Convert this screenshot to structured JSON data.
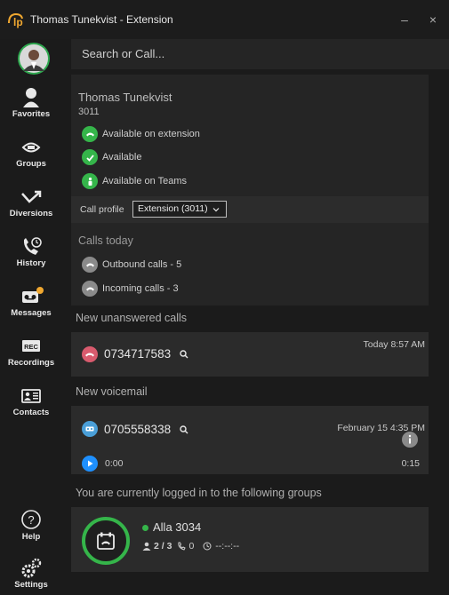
{
  "window": {
    "title": "Thomas Tunekvist - Extension",
    "minimize": "–",
    "close": "×"
  },
  "search": {
    "placeholder": "Search or Call..."
  },
  "sidebar": {
    "items": [
      {
        "label": "Favorites",
        "icon": "person-icon"
      },
      {
        "label": "Groups",
        "icon": "groups-icon"
      },
      {
        "label": "Diversions",
        "icon": "diversion-arrow-icon"
      },
      {
        "label": "History",
        "icon": "history-phone-icon"
      },
      {
        "label": "Messages",
        "icon": "voicemail-icon"
      },
      {
        "label": "Recordings",
        "icon": "rec-icon"
      },
      {
        "label": "Contacts",
        "icon": "contact-card-icon"
      },
      {
        "label": "Help",
        "icon": "help-icon"
      },
      {
        "label": "Settings",
        "icon": "gears-icon"
      }
    ]
  },
  "profile": {
    "name": "Thomas Tunekvist",
    "extension": "3011",
    "statuses": [
      {
        "text": "Available on extension",
        "icon": "phone-icon"
      },
      {
        "text": "Available",
        "icon": "check-icon"
      },
      {
        "text": "Available on Teams",
        "icon": "teams-icon"
      }
    ],
    "call_profile_label": "Call profile",
    "call_profile_value": "Extension (3011)"
  },
  "calls_today": {
    "heading": "Calls today",
    "outbound": "Outbound calls - 5",
    "incoming": "Incoming calls - 3"
  },
  "unanswered": {
    "heading": "New unanswered calls",
    "number": "0734717583",
    "time": "Today 8:57 AM"
  },
  "voicemail": {
    "heading": "New voicemail",
    "number": "0705558338",
    "date": "February 15 4:35 PM",
    "position": "0:00",
    "duration": "0:15"
  },
  "groups": {
    "heading": "You are currently logged in to the following groups",
    "name": "Alla 3034",
    "members": "2 / 3",
    "calls": "0",
    "timer": "--:--:--"
  },
  "colors": {
    "green": "#35b54a",
    "missed": "#d95b6e",
    "voicemail": "#4a9fd8",
    "play": "#1e90ff",
    "badge": "#f0a830",
    "logo": "#f0a830"
  }
}
